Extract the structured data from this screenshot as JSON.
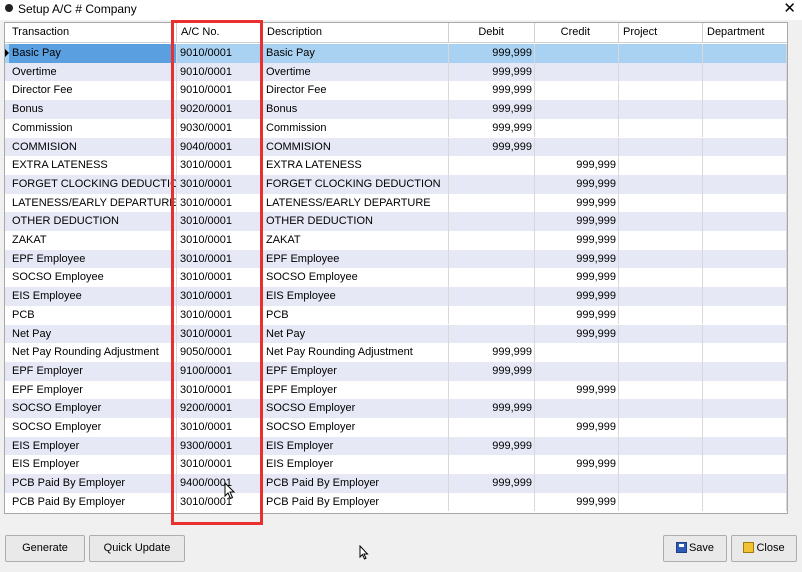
{
  "window": {
    "title": "Setup A/C # Company",
    "close_glyph": "✕"
  },
  "grid": {
    "columns": [
      "Transaction",
      "A/C No.",
      "Description",
      "Debit",
      "Credit",
      "Project",
      "Department"
    ],
    "rows": [
      {
        "transaction": "Basic Pay",
        "ac_no": "9010/0001",
        "description": "Basic Pay",
        "debit": "999,999",
        "credit": ""
      },
      {
        "transaction": "Overtime",
        "ac_no": "9010/0001",
        "description": "Overtime",
        "debit": "999,999",
        "credit": ""
      },
      {
        "transaction": "Director Fee",
        "ac_no": "9010/0001",
        "description": "Director Fee",
        "debit": "999,999",
        "credit": ""
      },
      {
        "transaction": "Bonus",
        "ac_no": "9020/0001",
        "description": "Bonus",
        "debit": "999,999",
        "credit": ""
      },
      {
        "transaction": "Commission",
        "ac_no": "9030/0001",
        "description": "Commission",
        "debit": "999,999",
        "credit": ""
      },
      {
        "transaction": "COMMISION",
        "ac_no": "9040/0001",
        "description": "COMMISION",
        "debit": "999,999",
        "credit": ""
      },
      {
        "transaction": "EXTRA LATENESS",
        "ac_no": "3010/0001",
        "description": "EXTRA LATENESS",
        "debit": "",
        "credit": "999,999"
      },
      {
        "transaction": "FORGET CLOCKING DEDUCTION",
        "ac_no": "3010/0001",
        "description": "FORGET CLOCKING DEDUCTION",
        "debit": "",
        "credit": "999,999"
      },
      {
        "transaction": "LATENESS/EARLY DEPARTURE",
        "ac_no": "3010/0001",
        "description": "LATENESS/EARLY DEPARTURE",
        "debit": "",
        "credit": "999,999"
      },
      {
        "transaction": "OTHER DEDUCTION",
        "ac_no": "3010/0001",
        "description": "OTHER DEDUCTION",
        "debit": "",
        "credit": "999,999"
      },
      {
        "transaction": "ZAKAT",
        "ac_no": "3010/0001",
        "description": "ZAKAT",
        "debit": "",
        "credit": "999,999"
      },
      {
        "transaction": "EPF Employee",
        "ac_no": "3010/0001",
        "description": "EPF Employee",
        "debit": "",
        "credit": "999,999"
      },
      {
        "transaction": "SOCSO Employee",
        "ac_no": "3010/0001",
        "description": "SOCSO Employee",
        "debit": "",
        "credit": "999,999"
      },
      {
        "transaction": "EIS Employee",
        "ac_no": "3010/0001",
        "description": "EIS Employee",
        "debit": "",
        "credit": "999,999"
      },
      {
        "transaction": "PCB",
        "ac_no": "3010/0001",
        "description": "PCB",
        "debit": "",
        "credit": "999,999"
      },
      {
        "transaction": "Net Pay",
        "ac_no": "3010/0001",
        "description": "Net Pay",
        "debit": "",
        "credit": "999,999"
      },
      {
        "transaction": "Net Pay Rounding Adjustment",
        "ac_no": "9050/0001",
        "description": "Net Pay Rounding Adjustment",
        "debit": "999,999",
        "credit": ""
      },
      {
        "transaction": "EPF Employer",
        "ac_no": "9100/0001",
        "description": "EPF Employer",
        "debit": "999,999",
        "credit": ""
      },
      {
        "transaction": "EPF Employer",
        "ac_no": "3010/0001",
        "description": "EPF Employer",
        "debit": "",
        "credit": "999,999"
      },
      {
        "transaction": "SOCSO Employer",
        "ac_no": "9200/0001",
        "description": "SOCSO Employer",
        "debit": "999,999",
        "credit": ""
      },
      {
        "transaction": "SOCSO Employer",
        "ac_no": "3010/0001",
        "description": "SOCSO Employer",
        "debit": "",
        "credit": "999,999"
      },
      {
        "transaction": "EIS Employer",
        "ac_no": "9300/0001",
        "description": "EIS Employer",
        "debit": "999,999",
        "credit": ""
      },
      {
        "transaction": "EIS Employer",
        "ac_no": "3010/0001",
        "description": "EIS Employer",
        "debit": "",
        "credit": "999,999"
      },
      {
        "transaction": "PCB Paid By Employer",
        "ac_no": "9400/0001",
        "description": "PCB Paid By Employer",
        "debit": "999,999",
        "credit": ""
      },
      {
        "transaction": "PCB Paid By Employer",
        "ac_no": "3010/0001",
        "description": "PCB Paid By Employer",
        "debit": "",
        "credit": "999,999"
      }
    ]
  },
  "buttons": {
    "generate": "Generate",
    "quick_update": "Quick Update",
    "save": "Save",
    "close": "Close"
  },
  "colors": {
    "highlight": "#e8312f",
    "selected_row": "#a9d2f2",
    "alt_row": "#e6e8f5"
  }
}
